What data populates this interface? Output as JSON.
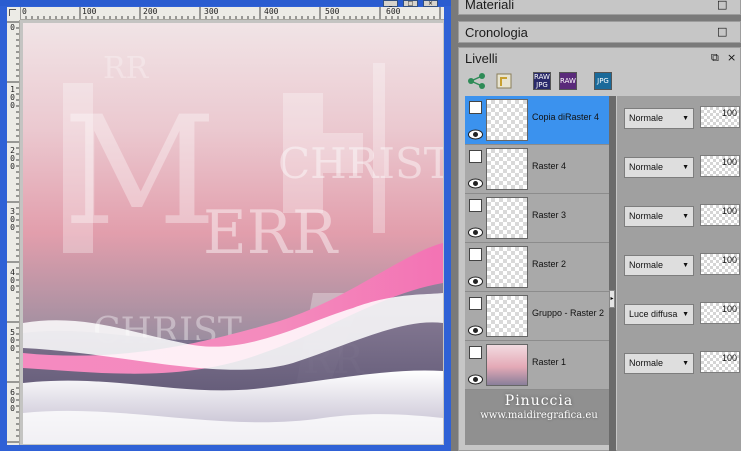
{
  "canvas": {
    "ruler_h_labels": [
      "0",
      "100",
      "200",
      "300",
      "400",
      "500",
      "600"
    ],
    "ruler_v_labels": [
      "0",
      "100",
      "200",
      "300",
      "400",
      "500",
      "600"
    ],
    "artwork_text": [
      "MERRY",
      "CHRIST",
      "CHRIST",
      "ERR",
      "RR",
      "RR",
      "M"
    ]
  },
  "panels": {
    "materiali": {
      "title": "Materiali"
    },
    "cronologia": {
      "title": "Cronologia"
    },
    "livelli": {
      "title": "Livelli"
    }
  },
  "toolbar": [
    "RAW JPG",
    "RAW",
    "JPG"
  ],
  "layers": [
    {
      "name": "Copia diRaster 4",
      "blend": "Normale",
      "opacity": "100",
      "selected": true
    },
    {
      "name": "Raster 4",
      "blend": "Normale",
      "opacity": "100",
      "selected": false
    },
    {
      "name": "Raster 3",
      "blend": "Normale",
      "opacity": "100",
      "selected": false
    },
    {
      "name": "Raster 2",
      "blend": "Normale",
      "opacity": "100",
      "selected": false
    },
    {
      "name": "Gruppo - Raster 2",
      "blend": "Luce diffusa",
      "opacity": "100",
      "selected": false
    },
    {
      "name": "Raster 1",
      "blend": "Normale",
      "opacity": "100",
      "selected": false
    }
  ],
  "watermark": {
    "line1": "Pinuccia",
    "line2": "www.maidiregrafica.eu"
  },
  "colors": {
    "selection": "#3b92ee",
    "accent_pink": "#f07bb5",
    "window_blue": "#2f61d6"
  }
}
